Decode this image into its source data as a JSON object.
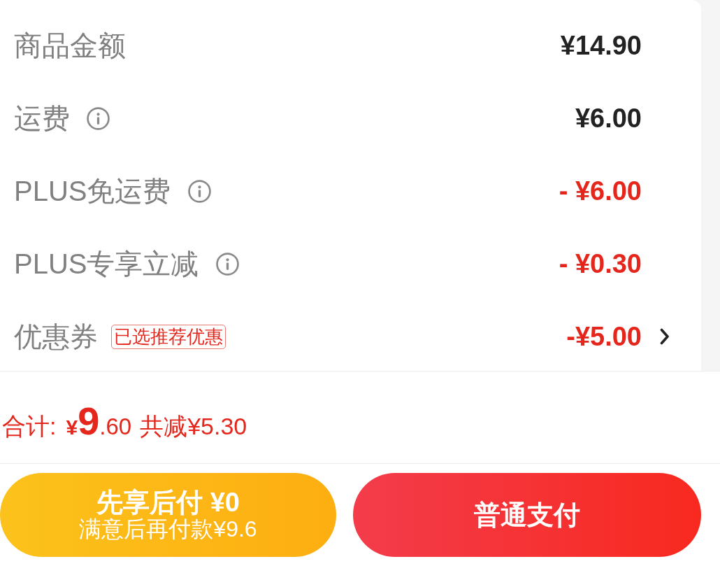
{
  "fee_rows": [
    {
      "label": "商品金额",
      "info_icon": false,
      "kind": "charge",
      "amount": "¥14.90",
      "chevron": false
    },
    {
      "label": "运费",
      "info_icon": true,
      "kind": "charge",
      "amount": "¥6.00",
      "chevron": false
    },
    {
      "label": "PLUS免运费",
      "info_icon": true,
      "kind": "discount",
      "amount": "- ¥6.00",
      "chevron": false
    },
    {
      "label": "PLUS专享立减",
      "info_icon": true,
      "kind": "discount",
      "amount": "- ¥0.30",
      "chevron": false
    },
    {
      "label": "优惠券",
      "info_icon": false,
      "tag": "已选推荐优惠",
      "kind": "discount",
      "amount": "-¥5.00",
      "chevron": true
    }
  ],
  "total": {
    "label": "合计:",
    "currency": "¥",
    "integer": "9",
    "decimal": ".60",
    "saving": "共减¥5.30"
  },
  "buttons": [
    {
      "kind": "pay_later",
      "title": "先享后付 ¥0",
      "subtitle": "满意后再付款¥9.6"
    },
    {
      "kind": "pay_now",
      "title": "普通支付"
    }
  ]
}
